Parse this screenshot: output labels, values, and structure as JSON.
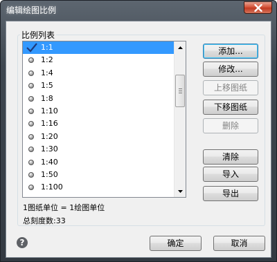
{
  "window": {
    "title": "编辑绘图比例"
  },
  "group": {
    "label": "比例列表"
  },
  "scale_list": {
    "selected_index": 0,
    "items": [
      "1:1",
      "1:2",
      "1:4",
      "1:5",
      "1:8",
      "1:10",
      "1:16",
      "1:20",
      "1:30",
      "1:40",
      "1:50",
      "1:100"
    ]
  },
  "buttons": {
    "add": "添加...",
    "edit": "修改...",
    "move_up": "上移图纸",
    "move_down": "下移图纸",
    "delete": "删除",
    "clear": "清除",
    "import": "导入",
    "export": "导出",
    "ok": "确定",
    "cancel": "取消"
  },
  "info": {
    "unit_line": "1图纸单位 = 1绘图单位",
    "total_line": "总刻度数:33"
  },
  "icons": {
    "close": "close-icon",
    "help": "help-icon",
    "check": "check-icon"
  },
  "colors": {
    "selection": "#3399ff",
    "close_button": "#c13b22"
  }
}
